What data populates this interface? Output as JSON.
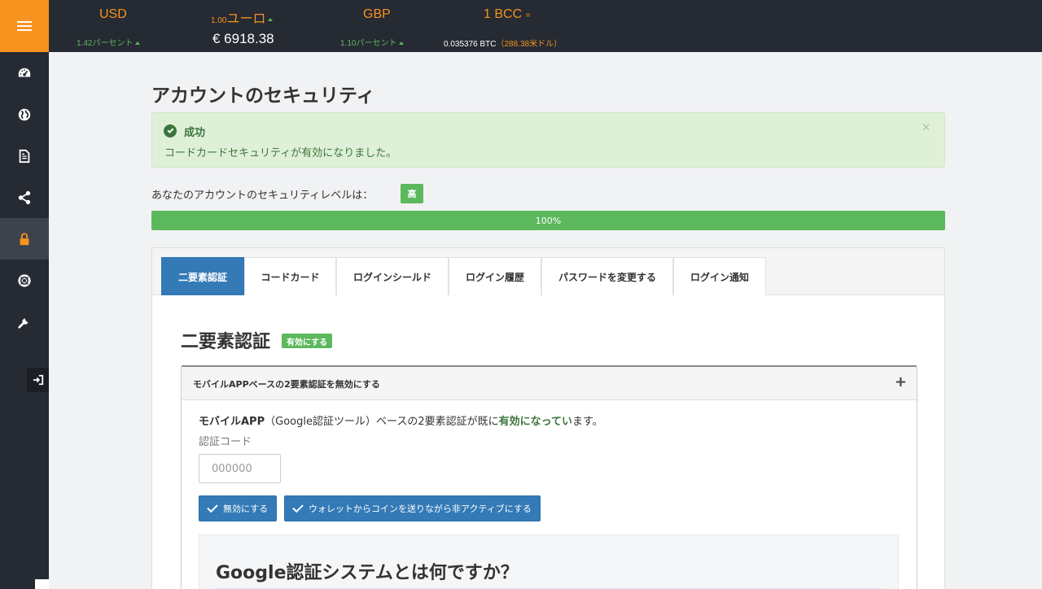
{
  "ticker": {
    "usd": {
      "label": "USD",
      "change": "1.42パーセント"
    },
    "eur": {
      "prefix": "1.00",
      "label": "ユーロ",
      "value": "€ 6918.38"
    },
    "gbp": {
      "label": "GBP",
      "change": "1.10パーセント"
    },
    "bcc": {
      "label": "1 BCC",
      "suffix": "=",
      "btc": "0.035376 BTC",
      "usd": "（288.38米ドル）"
    }
  },
  "sidebar": {
    "items": [
      {
        "name": "dashboard",
        "icon": "dashboard-icon"
      },
      {
        "name": "globe",
        "icon": "globe-icon"
      },
      {
        "name": "document",
        "icon": "document-icon"
      },
      {
        "name": "share",
        "icon": "share-icon"
      },
      {
        "name": "security",
        "icon": "lock-icon",
        "active": true
      },
      {
        "name": "support",
        "icon": "lifebuoy-icon"
      },
      {
        "name": "tools",
        "icon": "wrench-icon"
      }
    ],
    "logout_icon": "sign-out-icon"
  },
  "page": {
    "title": "アカウントのセキュリティ"
  },
  "alert": {
    "title": "成功",
    "message": "コードカードセキュリティが有効になりました。",
    "close": "×"
  },
  "security_level": {
    "text": "あなたのアカウントのセキュリティレベルは：",
    "badge": "高",
    "progress_label": "100%",
    "progress": 1.0
  },
  "tabs": [
    {
      "label": "二要素認証",
      "active": true
    },
    {
      "label": "コードカード"
    },
    {
      "label": "ログインシールド"
    },
    {
      "label": "ログイン履歴"
    },
    {
      "label": "パスワードを変更する"
    },
    {
      "label": "ログイン通知"
    }
  ],
  "section": {
    "title": "二要素認証",
    "badge": "有効にする"
  },
  "accordion": {
    "title": "モバイルAPPベースの2要素認証を無効にする",
    "toggle": "+",
    "info_strong": "モバイルAPP",
    "info_mid": "（Google認証ツール）ベースの2要素認証が既に",
    "info_green": "有効になってい",
    "info_end": "ます。",
    "code_label": "認証コード",
    "code_placeholder": "000000",
    "btn_disable": "無効にする",
    "btn_disable_send": "ウォレットからコインを送りながら非アクティブにする",
    "info_box_title": "Google認証システムとは何ですか？"
  },
  "colors": {
    "sidebar": "#262a33",
    "accent_orange": "#f7931e",
    "success_green": "#5cb85c",
    "primary_blue": "#337ab7"
  }
}
